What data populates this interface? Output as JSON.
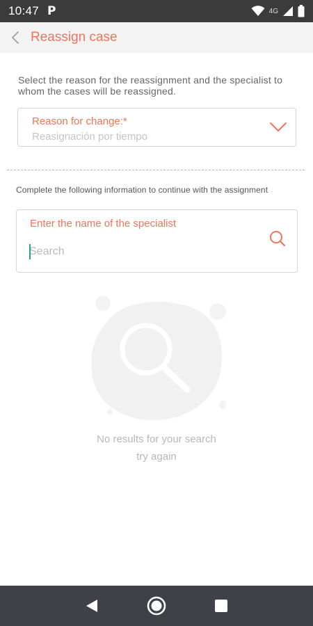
{
  "status_bar": {
    "time": "10:47",
    "app_indicator": "P",
    "network": "4G",
    "icons": [
      "wifi-icon",
      "signal-icon",
      "battery-icon"
    ]
  },
  "header": {
    "title": "Reassign case",
    "back_icon": "chevron-left-icon"
  },
  "reason_section": {
    "instruction": "Select the reason for the reassignment and the specialist to whom the cases will be reassigned.",
    "label": "Reason for change:*",
    "value": "Reasignación por tiempo",
    "dropdown_icon": "chevron-down-icon"
  },
  "specialist_section": {
    "instruction": "Complete the following information to continue with the assignment",
    "label": "Enter the name of the specialist",
    "placeholder": "Search",
    "value": "",
    "search_icon": "search-icon"
  },
  "empty_state": {
    "line1": "No results for your search",
    "line2": "try again",
    "illustration_icon": "magnifier-illustration"
  },
  "nav_bar": {
    "buttons": [
      "back-triangle-icon",
      "home-circle-icon",
      "recents-square-icon"
    ]
  },
  "colors": {
    "accent": "#f0735a",
    "status_bar": "#3b3b3b",
    "header_bg": "#f3f3f3",
    "nav_bar": "#3e4247",
    "muted_text": "#b8b8b8"
  }
}
